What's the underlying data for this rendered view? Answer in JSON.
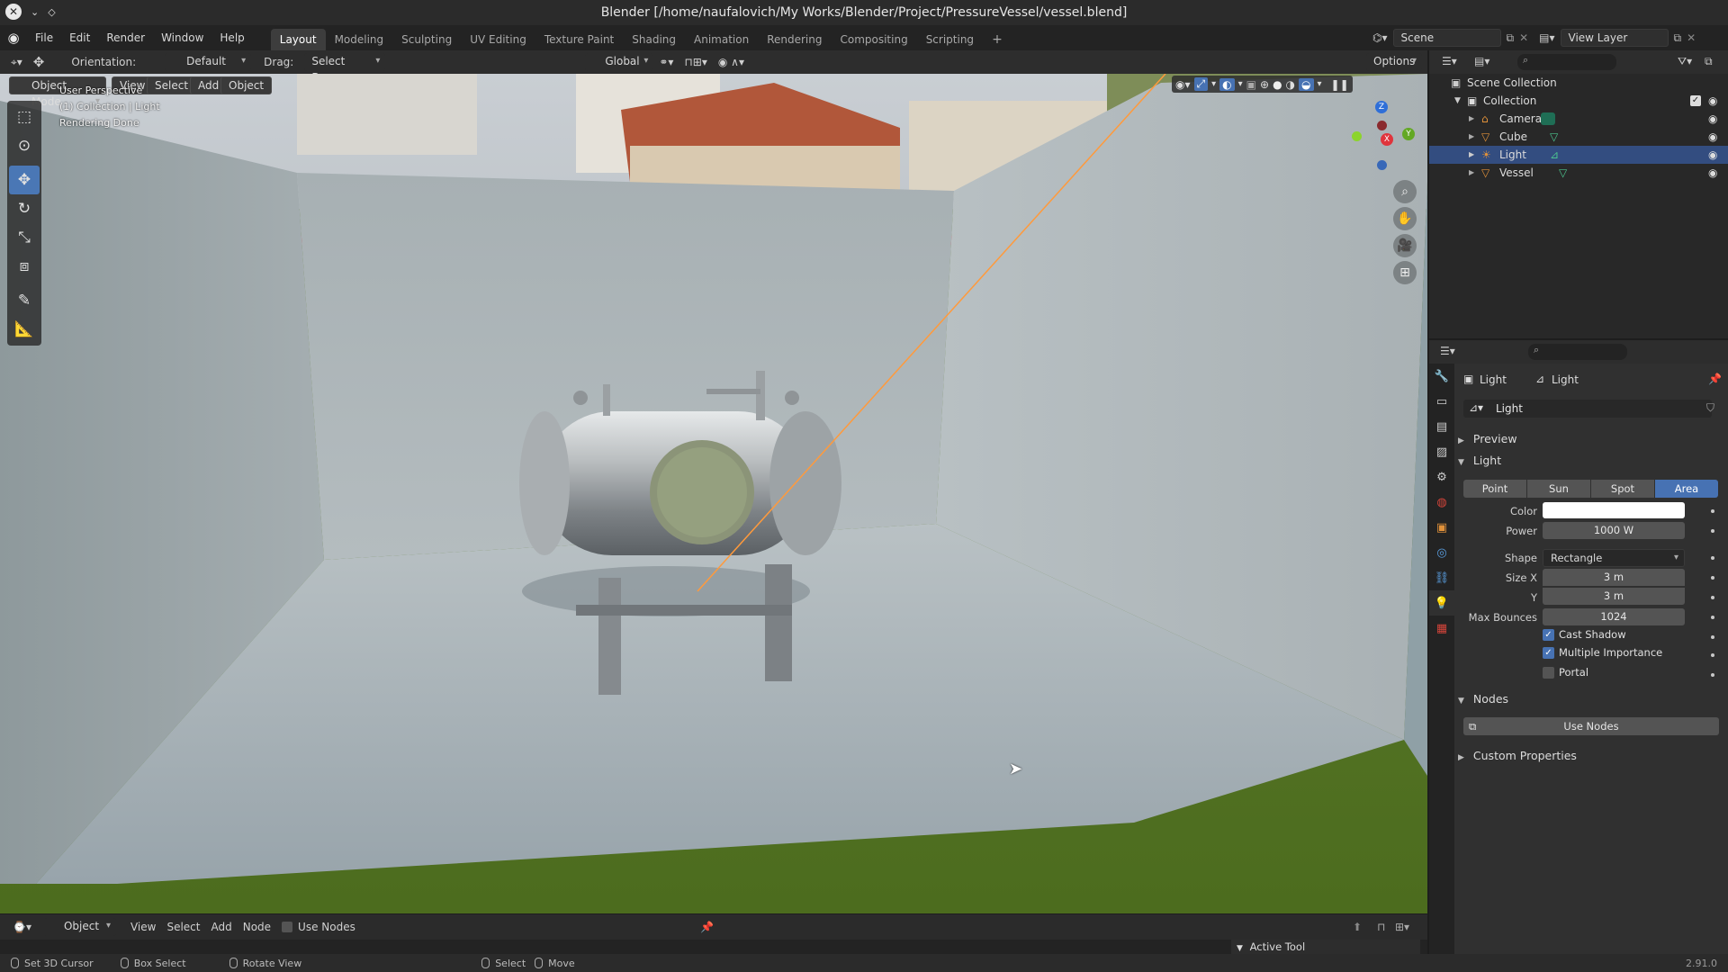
{
  "window": {
    "title": "Blender [/home/naufalovich/My Works/Blender/Project/PressureVessel/vessel.blend]"
  },
  "menu": [
    "File",
    "Edit",
    "Render",
    "Window",
    "Help"
  ],
  "workspaces": [
    "Layout",
    "Modeling",
    "Sculpting",
    "UV Editing",
    "Texture Paint",
    "Shading",
    "Animation",
    "Rendering",
    "Compositing",
    "Scripting"
  ],
  "active_workspace": "Layout",
  "scene": {
    "name": "Scene",
    "view_layer": "View Layer"
  },
  "header": {
    "orientation_label": "Orientation:",
    "orientation_value": "Default",
    "drag_label": "Drag:",
    "drag_value": "Select Box",
    "transform_orientation": "Global",
    "options_label": "Options"
  },
  "viewport": {
    "mode": "Object Mode",
    "menus": [
      "View",
      "Select",
      "Add",
      "Object"
    ],
    "overlay_lines": [
      "User Perspective",
      "(1) Collection | Light",
      "Rendering Done"
    ],
    "gizmo_axes": {
      "x": "X",
      "y": "Y",
      "z": "Z"
    }
  },
  "outliner": {
    "root": "Scene Collection",
    "collection": "Collection",
    "items": [
      {
        "name": "Camera",
        "selected": false
      },
      {
        "name": "Cube",
        "selected": false
      },
      {
        "name": "Light",
        "selected": true
      },
      {
        "name": "Vessel",
        "selected": false
      }
    ]
  },
  "properties": {
    "breadcrumb_object": "Light",
    "breadcrumb_data": "Light",
    "datablock": "Light",
    "panels": {
      "preview": "Preview",
      "light": "Light",
      "nodes": "Nodes",
      "custom": "Custom Properties"
    },
    "light_types": [
      "Point",
      "Sun",
      "Spot",
      "Area"
    ],
    "active_light_type": "Area",
    "color_label": "Color",
    "color_value": "#ffffff",
    "power_label": "Power",
    "power_value": "1000 W",
    "shape_label": "Shape",
    "shape_value": "Rectangle",
    "size_x_label": "Size X",
    "size_x_value": "3 m",
    "size_y_label": "Y",
    "size_y_value": "3 m",
    "max_bounces_label": "Max Bounces",
    "max_bounces_value": "1024",
    "cast_shadow": {
      "label": "Cast Shadow",
      "checked": true
    },
    "multiple_importance": {
      "label": "Multiple Importance",
      "checked": true
    },
    "portal": {
      "label": "Portal",
      "checked": false
    },
    "use_nodes_button": "Use Nodes"
  },
  "editor_bottom": {
    "mode": "Object",
    "menus": [
      "View",
      "Select",
      "Add",
      "Node"
    ],
    "use_nodes": "Use Nodes",
    "active_tool": "Active Tool"
  },
  "status": {
    "items": [
      "Set 3D Cursor",
      "Box Select",
      "Rotate View",
      "Select",
      "Move"
    ],
    "version": "2.91.0"
  },
  "colors": {
    "accent": "#4772b3",
    "selection": "#334d80",
    "light_line": "#ff9a3c"
  }
}
